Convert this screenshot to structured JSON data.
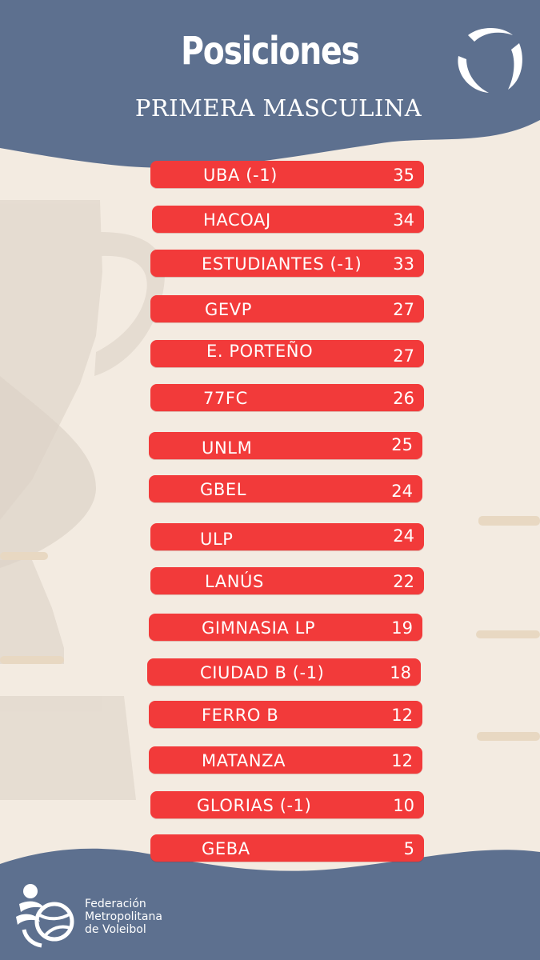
{
  "header": {
    "title": "Posiciones",
    "subtitle": "PRIMERA MASCULINA"
  },
  "standings": [
    {
      "team": "UBA (-1)",
      "points": "35"
    },
    {
      "team": "HACOAJ",
      "points": "34"
    },
    {
      "team": "ESTUDIANTES (-1)",
      "points": "33"
    },
    {
      "team": "GEVP",
      "points": "27"
    },
    {
      "team": "E. PORTEÑO",
      "points": "27"
    },
    {
      "team": "77FC",
      "points": "26"
    },
    {
      "team": "UNLM",
      "points": "25"
    },
    {
      "team": "GBEL",
      "points": "24"
    },
    {
      "team": "ULP",
      "points": "24"
    },
    {
      "team": "LANÚS",
      "points": "22"
    },
    {
      "team": "GIMNASIA LP",
      "points": "19"
    },
    {
      "team": "CIUDAD B (-1)",
      "points": "18"
    },
    {
      "team": "FERRO B",
      "points": "12"
    },
    {
      "team": "MATANZA",
      "points": "12"
    },
    {
      "team": "GLORIAS (-1)",
      "points": "10"
    },
    {
      "team": "GEBA",
      "points": "5"
    }
  ],
  "footer": {
    "brand_line1": "Federación",
    "brand_line2": "Metropolitana",
    "brand_line3": "de Voleibol"
  },
  "colors": {
    "header_bg": "#5d708f",
    "page_bg": "#f3ebe1",
    "row_bg": "#f23a3a",
    "text": "#ffffff"
  },
  "icons": {
    "top_logo": "volleyball-swirl-icon",
    "bottom_logo": "volleyball-player-logo-icon",
    "background": "trophy-silhouette"
  }
}
